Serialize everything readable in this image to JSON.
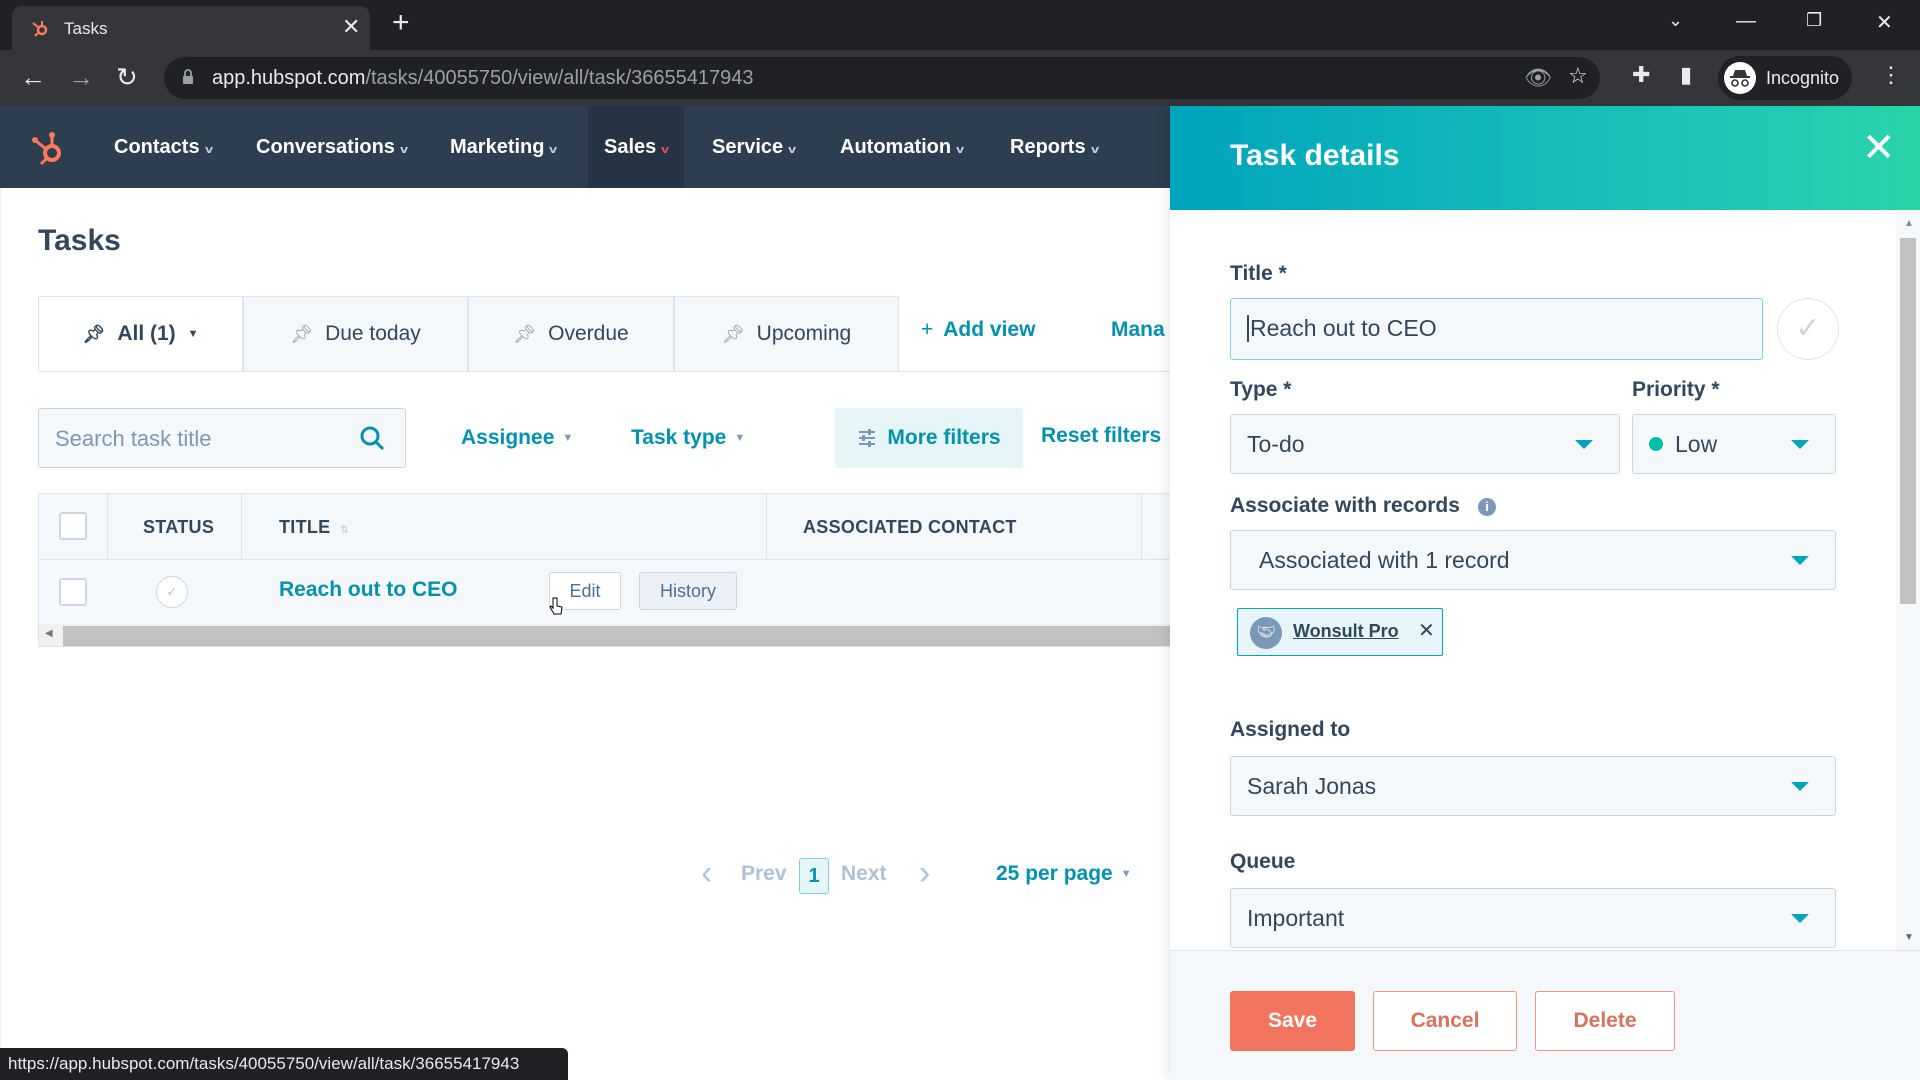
{
  "browser": {
    "tab_title": "Tasks",
    "url_host": "app.hubspot.com",
    "url_path": "/tasks/40055750/view/all/task/36655417943",
    "profile_label": "Incognito",
    "status_url": "https://app.hubspot.com/tasks/40055750/view/all/task/36655417943"
  },
  "nav": {
    "items": [
      {
        "label": "Contacts"
      },
      {
        "label": "Conversations"
      },
      {
        "label": "Marketing"
      },
      {
        "label": "Sales",
        "active": true
      },
      {
        "label": "Service"
      },
      {
        "label": "Automation"
      },
      {
        "label": "Reports"
      }
    ]
  },
  "page": {
    "title": "Tasks",
    "views": [
      {
        "label": "All (1)",
        "active": true
      },
      {
        "label": "Due today"
      },
      {
        "label": "Overdue"
      },
      {
        "label": "Upcoming"
      }
    ],
    "add_view": "Add view",
    "manage": "Mana",
    "search_placeholder": "Search task title",
    "filters": {
      "assignee": "Assignee",
      "task_type": "Task type",
      "more_filters": "More filters",
      "reset_filters": "Reset filters"
    },
    "table": {
      "columns": [
        "STATUS",
        "TITLE",
        "ASSOCIATED CONTACT"
      ],
      "rows": [
        {
          "title": "Reach out to CEO",
          "edit_label": "Edit",
          "history_label": "History"
        }
      ]
    },
    "pagination": {
      "prev": "Prev",
      "current_page": "1",
      "next": "Next",
      "per_page": "25 per page"
    }
  },
  "panel": {
    "title": "Task details",
    "fields": {
      "title_label": "Title *",
      "title_value": "Reach out to CEO",
      "type_label": "Type *",
      "type_value": "To-do",
      "priority_label": "Priority *",
      "priority_value": "Low",
      "priority_color": "#00bda5",
      "associate_label": "Associate with records",
      "associate_value": "Associated with 1 record",
      "associated_record": "Wonsult Pro",
      "assigned_label": "Assigned to",
      "assigned_value": "Sarah Jonas",
      "queue_label": "Queue",
      "queue_value": "Important"
    },
    "buttons": {
      "save": "Save",
      "cancel": "Cancel",
      "delete": "Delete"
    }
  },
  "colors": {
    "nav_bg": "#2d3e50",
    "accent_teal": "#0091ae",
    "save_orange": "#f2735e",
    "hubspot_orange": "#ff7a59"
  }
}
